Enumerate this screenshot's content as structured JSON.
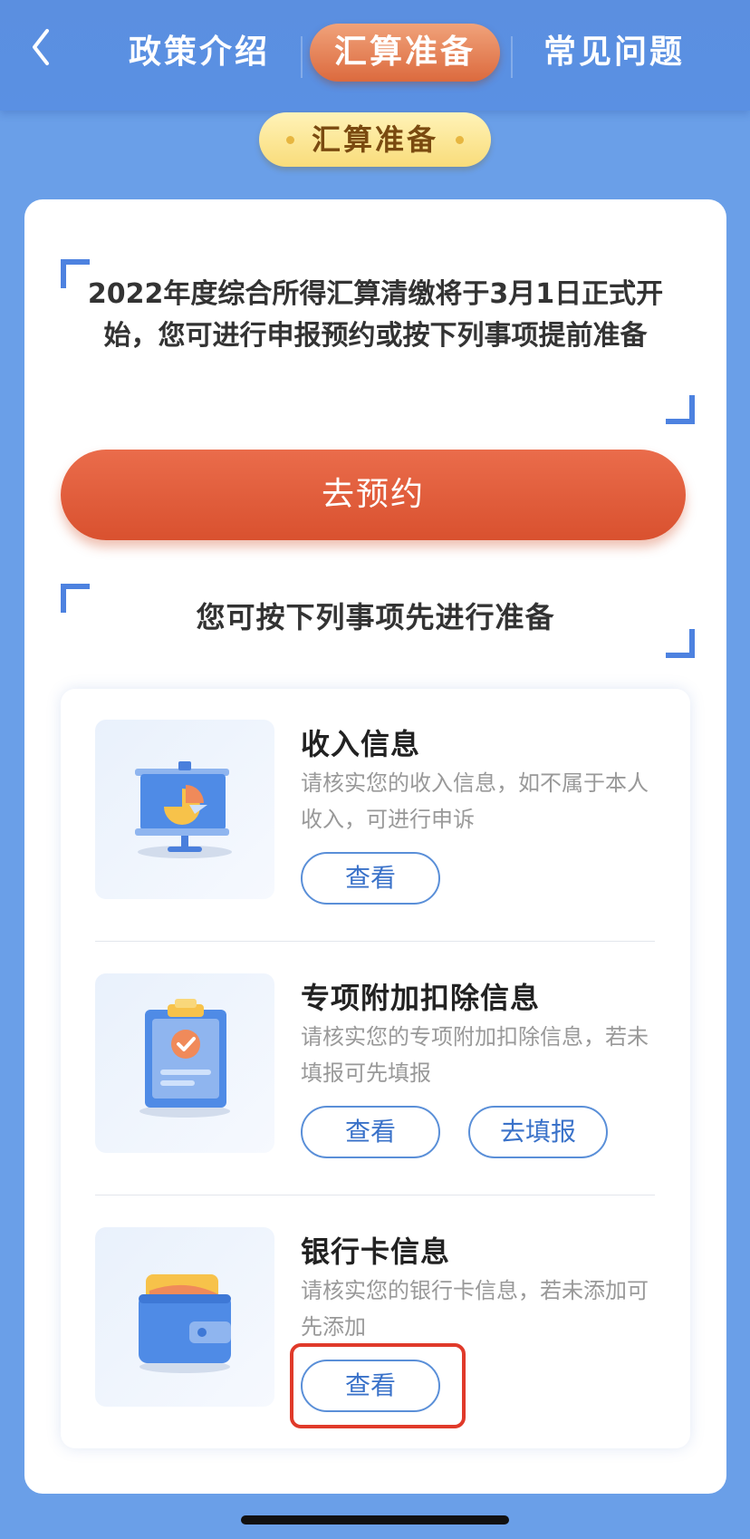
{
  "header": {
    "tabs": [
      {
        "label": "政策介绍"
      },
      {
        "label": "汇算准备"
      },
      {
        "label": "常见问题"
      }
    ]
  },
  "section_title": "汇算准备",
  "intro_text": "2022年度综合所得汇算清缴将于3月1日正式开始，您可进行申报预约或按下列事项提前准备",
  "reserve_button": "去预约",
  "prep_title": "您可按下列事项先进行准备",
  "items": [
    {
      "title": "收入信息",
      "desc": "请核实您的收入信息，如不属于本人收入，可进行申诉",
      "btn1": "查看"
    },
    {
      "title": "专项附加扣除信息",
      "desc": "请核实您的专项附加扣除信息，若未填报可先填报",
      "btn1": "查看",
      "btn2": "去填报"
    },
    {
      "title": "银行卡信息",
      "desc": "请核实您的银行卡信息，若未添加可先添加",
      "btn1": "查看"
    }
  ],
  "colors": {
    "background": "#6a9fe8",
    "header": "#5b8fe0",
    "active_tab": "#dc6a3e",
    "primary_button": "#e0593a",
    "outline_button": "#5a8fd8",
    "highlight": "#e03a2a"
  }
}
